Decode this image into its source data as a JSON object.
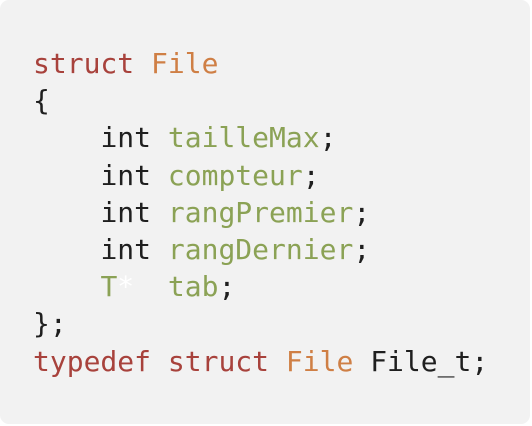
{
  "code": {
    "line1": {
      "keyword": "struct",
      "name": "File"
    },
    "line2": {
      "open_brace": "{"
    },
    "fields": [
      {
        "type": "int",
        "name": "tailleMax",
        "semi": ";"
      },
      {
        "type": "int",
        "name": "compteur",
        "semi": ";"
      },
      {
        "type": "int",
        "name": "rangPremier",
        "semi": ";"
      },
      {
        "type": "int",
        "name": "rangDernier",
        "semi": ";"
      }
    ],
    "pointer_field": {
      "type": "T",
      "star": "*",
      "name": "tab",
      "semi": ";"
    },
    "close": "};",
    "typedef_line": {
      "keyword1": "typedef",
      "keyword2": "struct",
      "name": "File",
      "alias": "File_t",
      "semi": ";"
    }
  },
  "colors": {
    "background": "#f2f2f2",
    "keyword": "#a8423c",
    "type_name": "#cf7f45",
    "identifier": "#8ba255",
    "plain": "#1f1f1f"
  }
}
